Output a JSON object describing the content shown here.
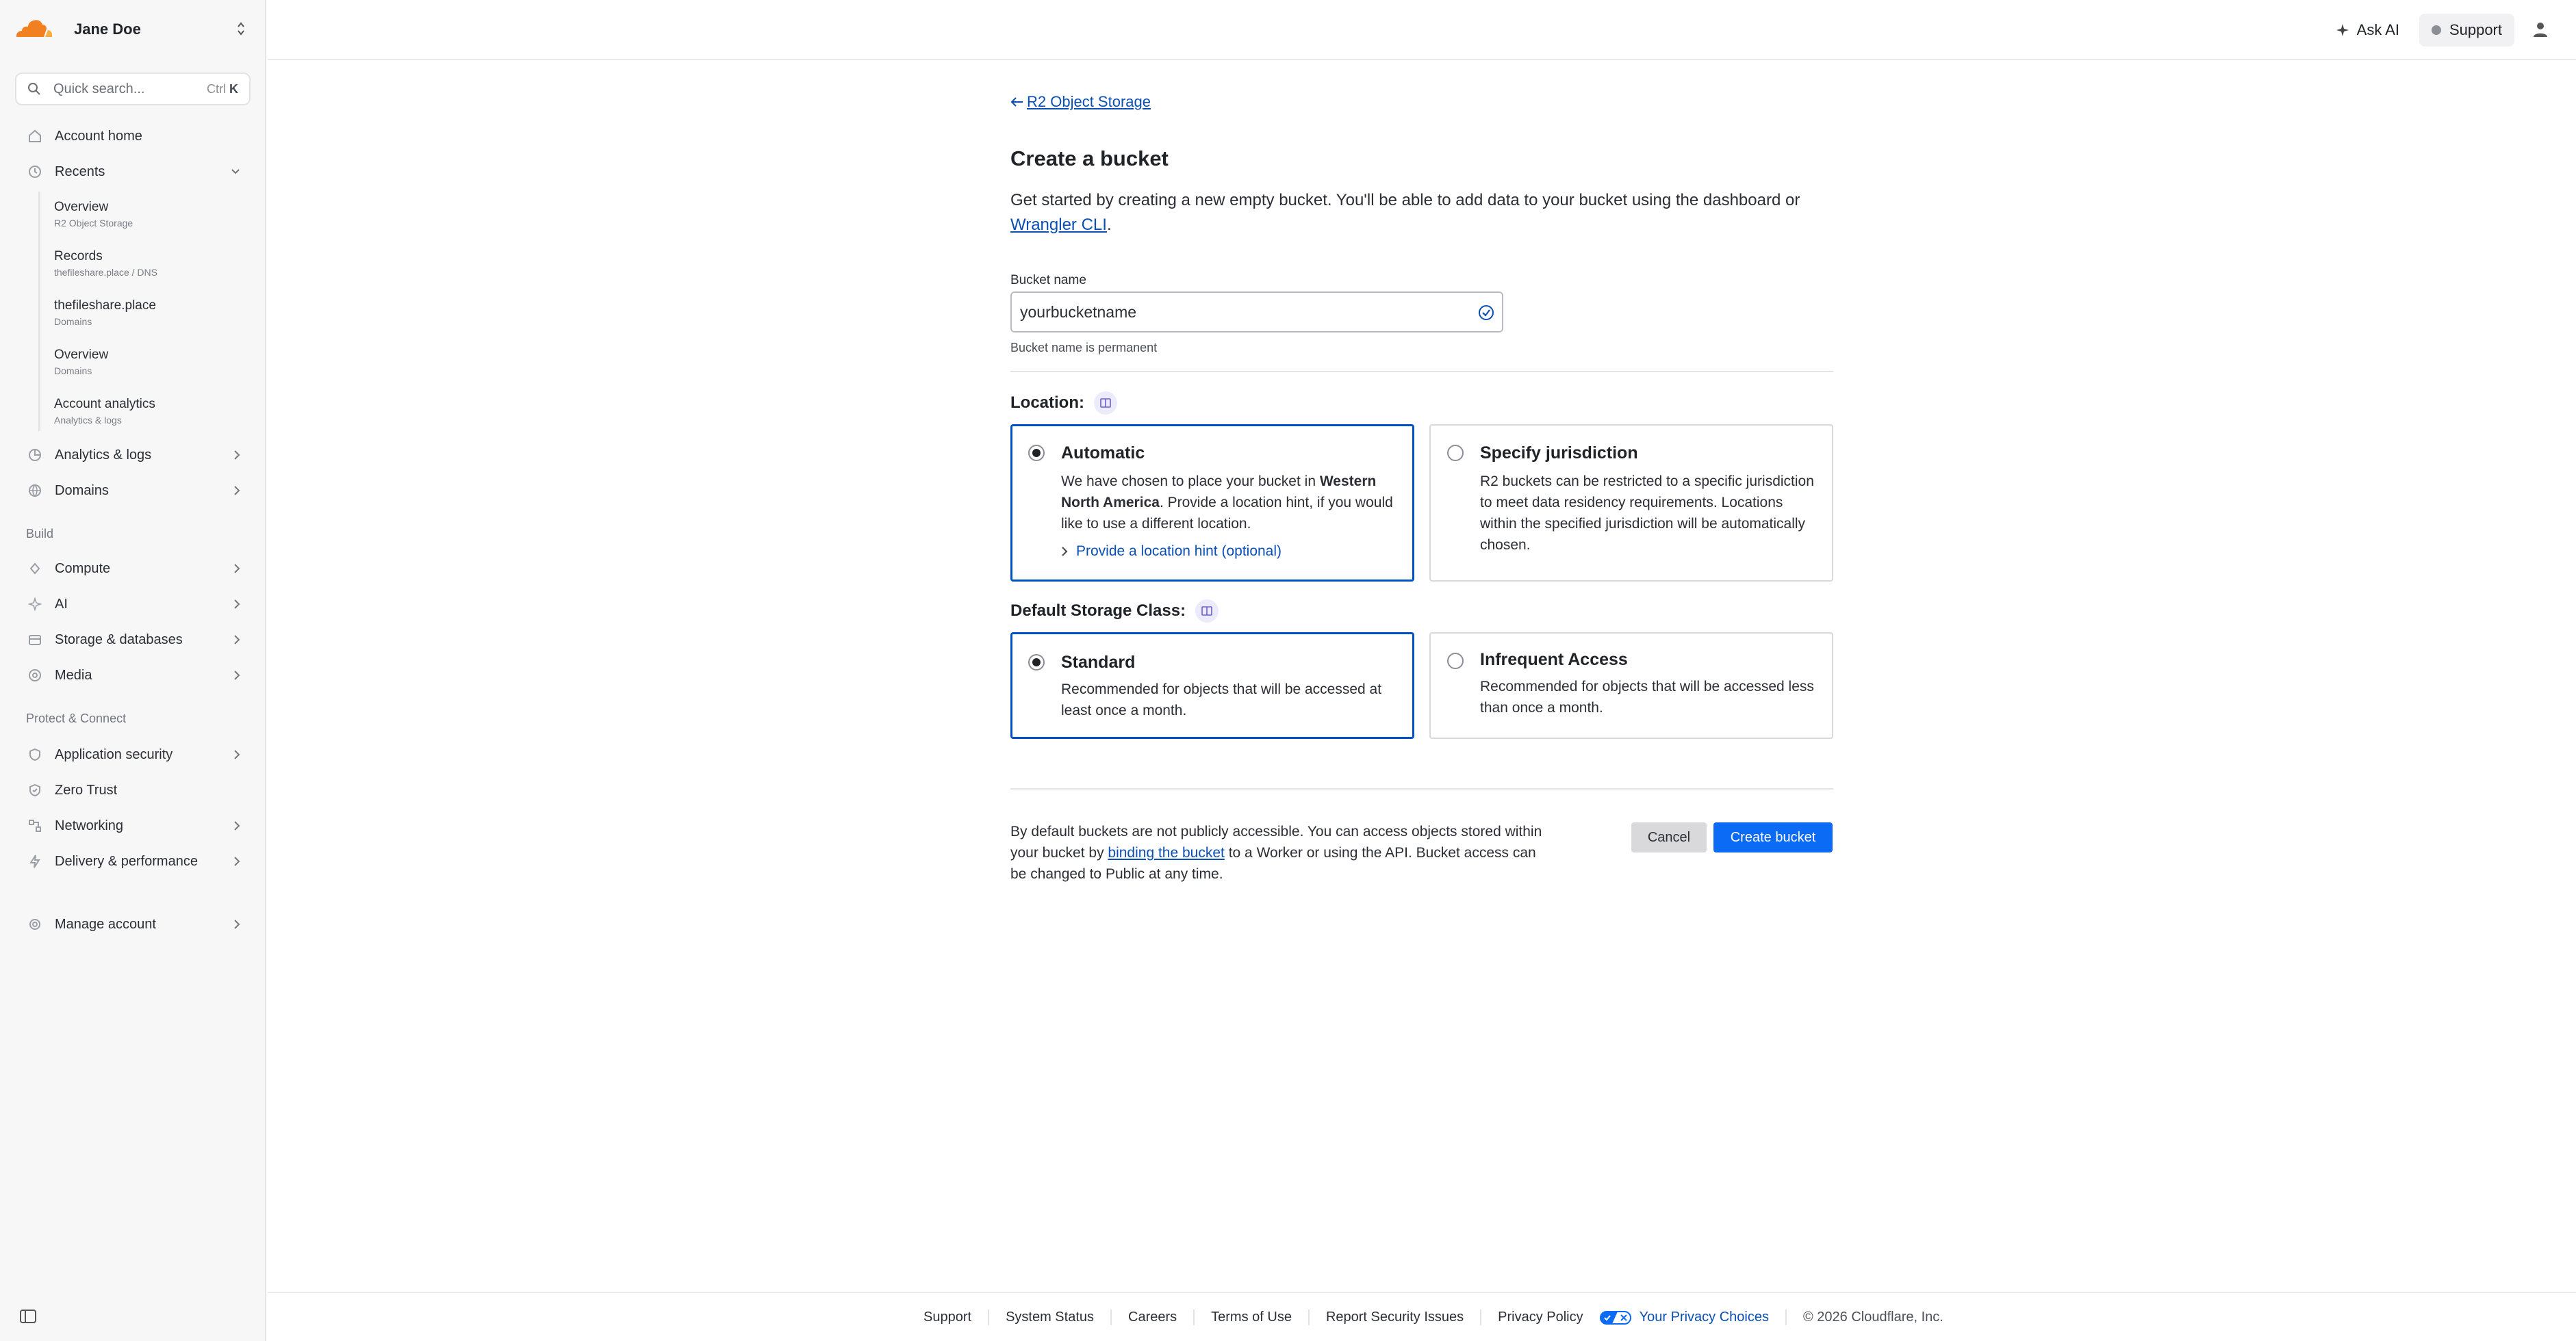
{
  "account": {
    "name": "Jane Doe"
  },
  "search": {
    "placeholder": "Quick search...",
    "shortcut_mod": "Ctrl",
    "shortcut_key": "K"
  },
  "sidebar": {
    "account_home": "Account home",
    "recents": "Recents",
    "recent_items": [
      {
        "title": "Overview",
        "sub": "R2 Object Storage"
      },
      {
        "title": "Records",
        "sub": "thefileshare.place  /  DNS"
      },
      {
        "title": "thefileshare.place",
        "sub": "Domains"
      },
      {
        "title": "Overview",
        "sub": "Domains"
      },
      {
        "title": "Account analytics",
        "sub": "Analytics & logs"
      }
    ],
    "analytics": "Analytics & logs",
    "domains": "Domains",
    "build_label": "Build",
    "compute": "Compute",
    "ai": "AI",
    "storage": "Storage & databases",
    "media": "Media",
    "protect_label": "Protect & Connect",
    "app_security": "Application security",
    "zero_trust": "Zero Trust",
    "networking": "Networking",
    "delivery": "Delivery & performance",
    "manage_account": "Manage account"
  },
  "topbar": {
    "ask_ai": "Ask AI",
    "support": "Support"
  },
  "main": {
    "back_link": "R2 Object Storage",
    "title": "Create a bucket",
    "intro_text": "Get started by creating a new empty bucket. You'll be able to add data to your bucket using the dashboard or ",
    "intro_link": "Wrangler CLI",
    "intro_end": ".",
    "bucket_label": "Bucket name",
    "bucket_value": "yourbucketname",
    "bucket_hint": "Bucket name is permanent",
    "location_heading": "Location:",
    "automatic_title": "Automatic",
    "automatic_desc_1": "We have chosen to place your bucket in ",
    "automatic_desc_bold": "Western North America",
    "automatic_desc_2": ". Provide a location hint, if you would like to use a different location.",
    "location_hint_link": "Provide a location hint (optional)",
    "jurisdiction_title": "Specify jurisdiction",
    "jurisdiction_desc": "R2 buckets can be restricted to a specific jurisdiction to meet data residency requirements. Locations within the specified jurisdiction will be automatically chosen.",
    "storage_class_heading": "Default Storage Class:",
    "standard_title": "Standard",
    "standard_desc": "Recommended for objects that will be accessed at least once a month.",
    "infrequent_title": "Infrequent Access",
    "infrequent_desc": "Recommended for objects that will be accessed less than once a month.",
    "note_1": "By default buckets are not publicly accessible. You can access objects stored within your bucket by ",
    "note_link": "binding the bucket",
    "note_2": " to a Worker or using the API. Bucket access can be changed to Public at any time.",
    "cancel": "Cancel",
    "create": "Create bucket"
  },
  "footer": {
    "links": [
      "Support",
      "System Status",
      "Careers",
      "Terms of Use",
      "Report Security Issues",
      "Privacy Policy"
    ],
    "privacy_choices": "Your Privacy Choices",
    "copyright": "© 2026 Cloudflare, Inc."
  },
  "colors": {
    "accent": "#0b6bf5",
    "link": "#0b4fb3",
    "brand_orange": "#f38020"
  }
}
